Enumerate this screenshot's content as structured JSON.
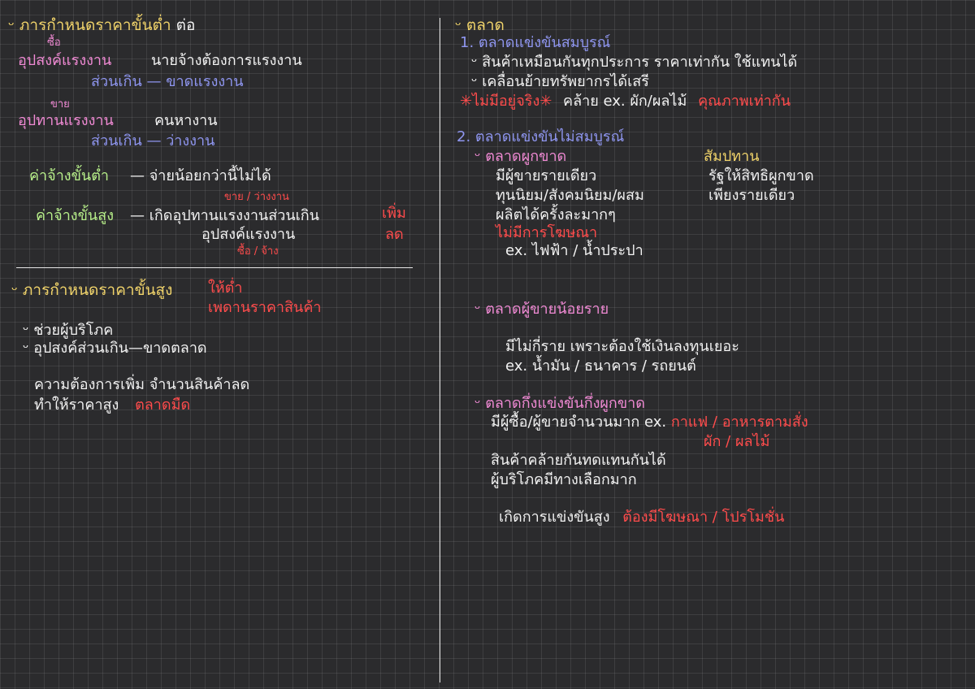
{
  "left": {
    "sec1": {
      "title_prefix": "ภารกำหนดราคาขั้นต่ำ",
      "title_suffix": "ต่อ",
      "supply_note": "ซื้อ",
      "supply_label": "อุปสงค์แรงงาน",
      "supply_desc": "นายจ้างต้องการแรงงาน",
      "supply_sub": "ส่วนเกิน — ขาดแรงงาน",
      "demand_note": "ขาย",
      "demand_label": "อุปทานแรงงาน",
      "demand_desc": "คนหางาน",
      "demand_sub": "ส่วนเกิน — ว่างงาน",
      "minwage_label": "ค่าจ้างขั้นต่ำ",
      "minwage_desc": "— จ่ายน้อยกว่านี้ไม่ได้",
      "maxwage_label": "ค่าจ้างขั้นสูง",
      "maxwage_desc": "— เกิดอุปทานแรงงานส่วนเกิน",
      "maxwage_desc2": "อุปสงค์แรงงาน",
      "note_sell": "ขาย / ว่างงาน",
      "note_buy": "ซื้อ / จ้าง",
      "note_up": "เพิ่ม",
      "note_down": "ลด"
    },
    "sec2": {
      "title": "ภารกำหนดราคาขั้นสูง",
      "note1": "ให้ต่ำ",
      "note2": "เพดานราคาสินค้า",
      "item1": "ช่วยผู้บริโภค",
      "item2": "อุปสงค์ส่วนเกิน—ขาดตลาด",
      "line1": "ความต้องการเพิ่ม  จำนวนสินค้าลด",
      "line2": "ทำให้ราคาสูง",
      "line2_red": "ตลาดมืด"
    }
  },
  "right": {
    "title": "ตลาด",
    "perfect": {
      "title": "1. ตลาดแข่งขันสมบูรณ์",
      "l1": "สินค้าเหมือนกันทุกประการ   ราคาเท่ากัน  ใช้แทนได้",
      "l2": "เคลื่อนย้ายทรัพยากรได้เสรี",
      "l3_red": "✳ไม่มีอยู่จริง✳",
      "l3": "คล้าย ex. ผัก/ผลไม้",
      "l3_red2": "คุณภาพเท่ากัน"
    },
    "imperfect": {
      "title": "2. ตลาดแข่งขันไม่สมบูรณ์",
      "monopoly": {
        "title": "ตลาดผูกขาด",
        "side_title": "สัมปทาน",
        "side_l1": "รัฐให้สิทธิผูกขาด",
        "side_l2": "เพียงรายเดียว",
        "l1": "มีผู้ขายรายเดียว",
        "l2": "ทุนนิยม/สังคมนิยม/ผสม",
        "l3": "ผลิตได้ครั้งละมากๆ",
        "l4_red": "ไม่มีการโฆษณา",
        "l5": "ex. ไฟฟ้า / น้ำประปา"
      },
      "oligopoly": {
        "title": "ตลาดผู้ขายน้อยราย",
        "l1": "มีไม่กี่ราย เพราะต้องใช้เงินลงทุนเยอะ",
        "l2": "ex. น้ำมัน / ธนาคาร / รถยนต์"
      },
      "monopolistic": {
        "title": "ตลาดกึ่งแข่งขันกึ่งผูกขาด",
        "l1": "มีผู้ซื้อ/ผู้ขายจำนวนมาก  ex.",
        "l1_red": "กาแฟ / อาหารตามสั่ง",
        "l1_red2": "ผัก / ผลไม้",
        "l2": "สินค้าคล้ายกันทดแทนกันได้",
        "l3": "ผู้บริโภคมีทางเลือกมาก",
        "l4": "เกิดการแข่งขันสูง",
        "l4_red": "ต้องมีโฆษณา / โปรโมชั่น"
      }
    }
  }
}
